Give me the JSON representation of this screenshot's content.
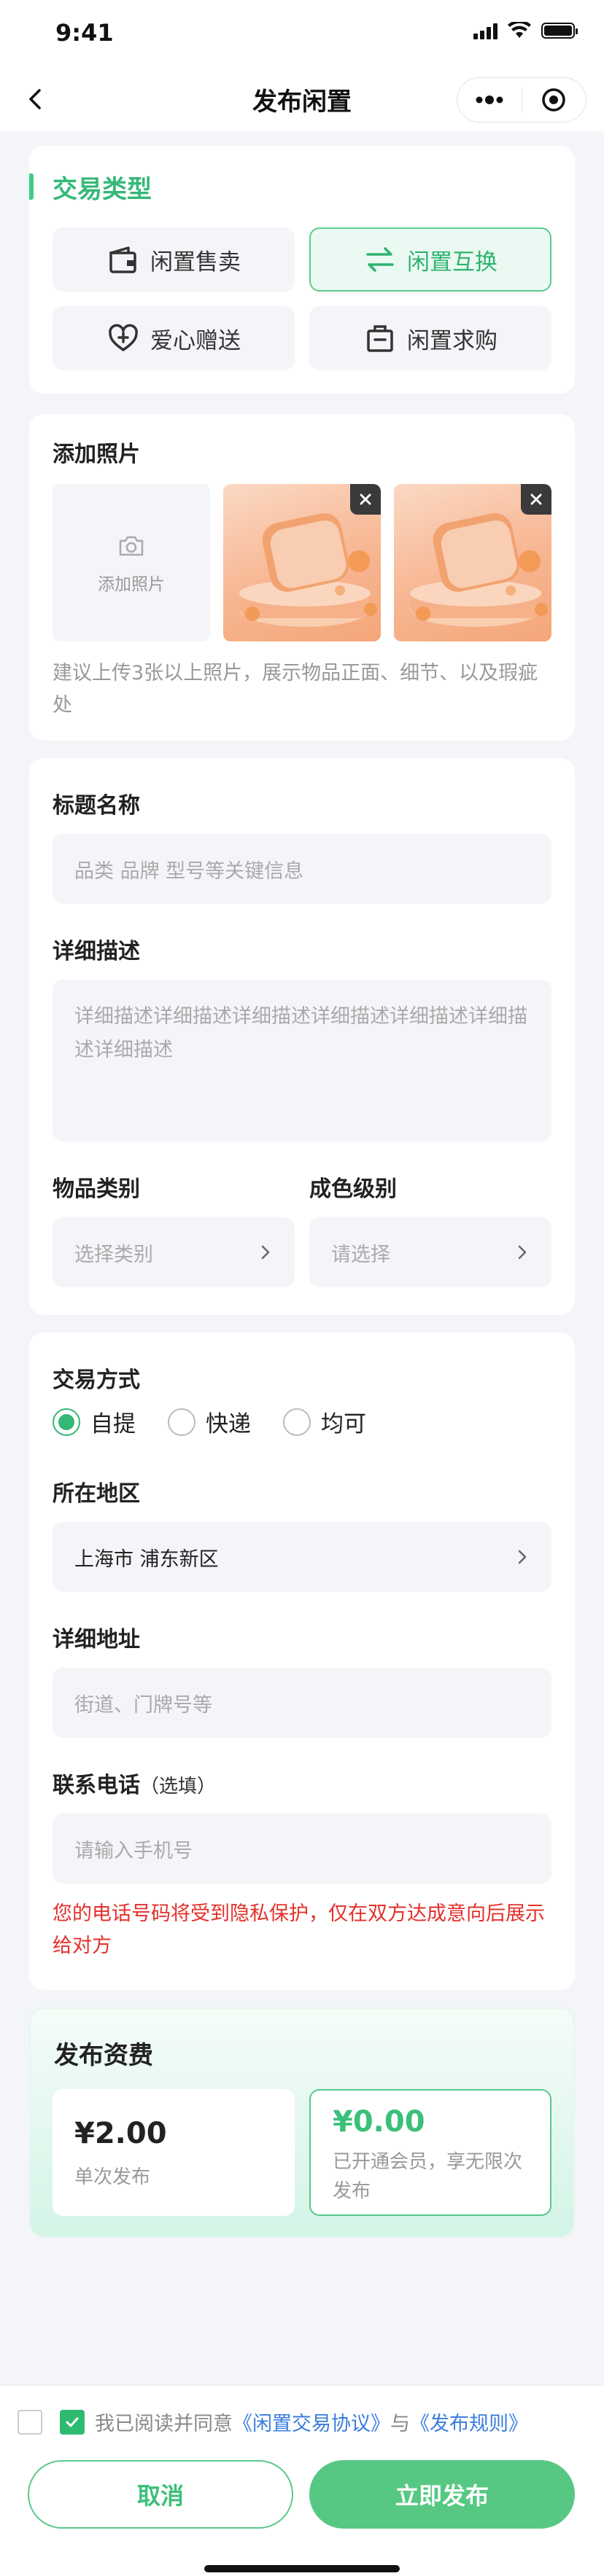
{
  "status_bar": {
    "time": "9:41"
  },
  "nav": {
    "title": "发布闲置",
    "more_icon": "more-dots-icon",
    "close_icon": "target-circle-icon"
  },
  "trade_type": {
    "title": "交易类型",
    "options": [
      {
        "label": "闲置售卖",
        "icon": "wallet-icon",
        "active": false
      },
      {
        "label": "闲置互换",
        "icon": "swap-arrows-icon",
        "active": true
      },
      {
        "label": "爱心赠送",
        "icon": "heart-plus-icon",
        "active": false
      },
      {
        "label": "闲置求购",
        "icon": "shopping-bag-icon",
        "active": false
      }
    ]
  },
  "photos": {
    "title": "添加照片",
    "add_label": "添加照片",
    "hint": "建议上传3张以上照片，展示物品正面、细节、以及瑕疵处"
  },
  "item": {
    "title_label": "标题名称",
    "title_placeholder": "品类 品牌 型号等关键信息",
    "desc_label": "详细描述",
    "desc_placeholder": "详细描述详细描述详细描述详细描述详细描述详细描述详细描述",
    "category_label": "物品类别",
    "category_placeholder": "选择类别",
    "condition_label": "成色级别",
    "condition_placeholder": "请选择"
  },
  "trade": {
    "method_label": "交易方式",
    "methods": [
      {
        "label": "自提",
        "selected": true
      },
      {
        "label": "快递",
        "selected": false
      },
      {
        "label": "均可",
        "selected": false
      }
    ],
    "region_label": "所在地区",
    "region_value": "上海市 浦东新区",
    "address_label": "详细地址",
    "address_placeholder": "街道、门牌号等",
    "phone_label": "联系电话",
    "phone_optional": "（选填）",
    "phone_placeholder": "请输入手机号",
    "privacy_note": "您的电话号码将受到隐私保护，仅在双方达成意向后展示给对方"
  },
  "fee": {
    "title": "发布资费",
    "single_price": "¥2.00",
    "single_desc": "单次发布",
    "member_price": "¥0.00",
    "member_desc": "已开通会员，享无限次发布"
  },
  "footer": {
    "agree_prefix": "我已阅读并同意",
    "agreement_link": "《闲置交易协议》",
    "and": "与",
    "rules_link": "《发布规则》",
    "cancel": "取消",
    "submit": "立即发布"
  },
  "colors": {
    "accent": "#3fcc85",
    "accent_dark": "#2fb36f",
    "danger": "#e4302b",
    "link": "#3a7ddc",
    "background": "#f4f5f9"
  }
}
